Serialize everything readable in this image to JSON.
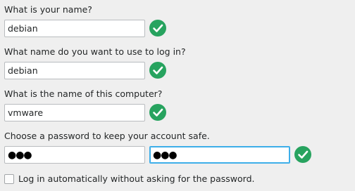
{
  "name_section": {
    "label": "What is your name?",
    "value": "debian",
    "status_icon": "check-circle-icon"
  },
  "login_section": {
    "label": "What name do you want to use to log in?",
    "value": "debian",
    "status_icon": "check-circle-icon"
  },
  "computer_section": {
    "label": "What is the name of this computer?",
    "value": "vmware",
    "status_icon": "check-circle-icon"
  },
  "password_section": {
    "label": "Choose a password to keep your account safe.",
    "password_value": "●●●",
    "confirm_value": "●●●",
    "status_icon": "check-circle-icon"
  },
  "autologin": {
    "label": "Log in automatically without asking for the password.",
    "checked": false
  },
  "colors": {
    "check_green": "#27a35f",
    "focus_border": "#3daee9",
    "background": "#efefef"
  }
}
